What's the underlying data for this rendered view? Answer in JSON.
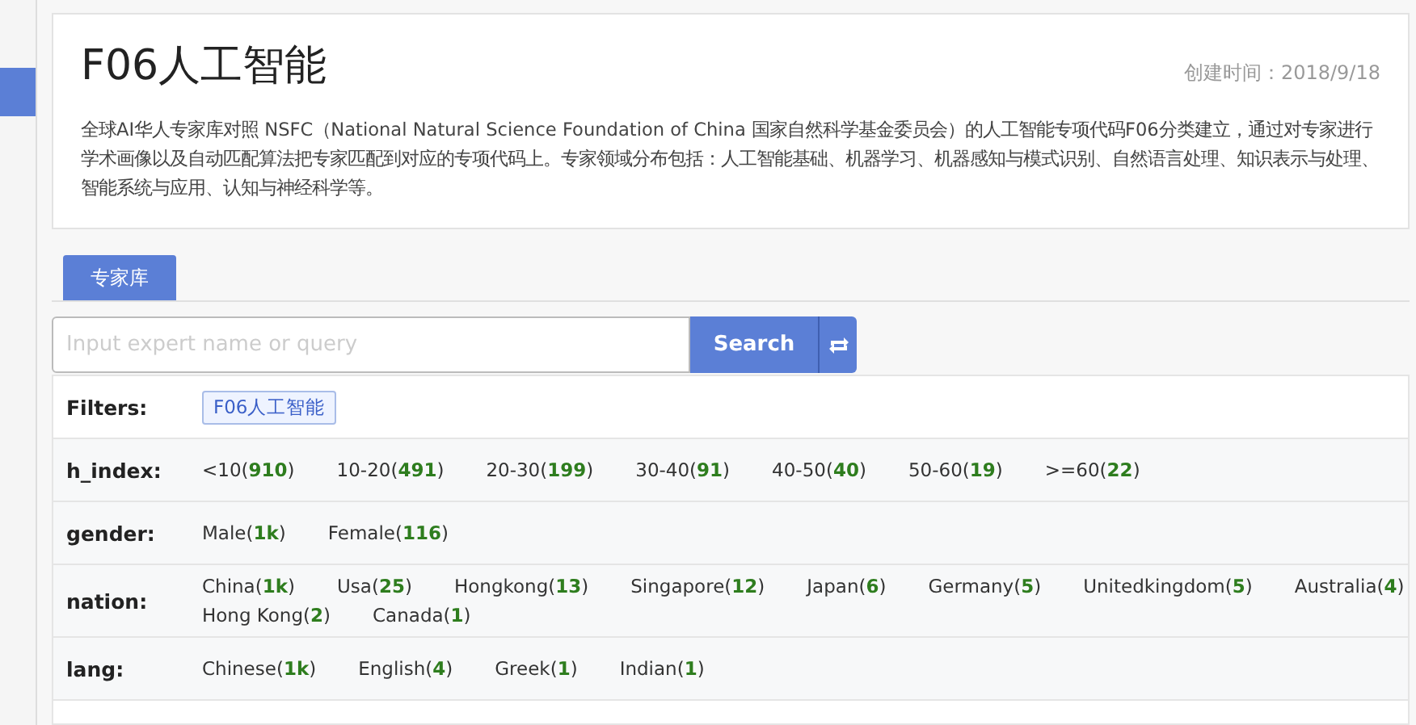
{
  "header": {
    "title": "F06人工智能",
    "created": "创建时间：2018/9/18",
    "description": "全球AI华人专家库对照 NSFC（National Natural Science Foundation of China 国家自然科学基金委员会）的人工智能专项代码F06分类建立，通过对专家进行学术画像以及自动匹配算法把专家匹配到对应的专项代码上。专家领域分布包括：人工智能基础、机器学习、机器感知与模式识别、自然语言处理、知识表示与处理、智能系统与应用、认知与神经科学等。"
  },
  "tabs": [
    {
      "label": "专家库",
      "selected": true
    }
  ],
  "search": {
    "placeholder": "Input expert name or query",
    "button": "Search"
  },
  "filters": {
    "label": "Filters:",
    "tags": [
      "F06人工智能"
    ]
  },
  "facets": [
    {
      "name": "h_index:",
      "items": [
        "<10(**910**)",
        "10-20(**491**)",
        "20-30(**199**)",
        "30-40(**91**)",
        "40-50(**40**)",
        "50-60(**19**)",
        ">=60(**22**)"
      ]
    },
    {
      "name": "gender:",
      "items": [
        "Male(**1k**)",
        "Female(**116**)"
      ]
    },
    {
      "name": "nation:",
      "items": [
        "China(**1k**)",
        "Usa(**25**)",
        "Hongkong(**13**)",
        "Singapore(**12**)",
        "Japan(**6**)",
        "Germany(**5**)",
        "Unitedkingdom(**5**)",
        "Australia(**4**)",
        "Hong Kong(**2**)",
        "Canada(**1**)"
      ]
    },
    {
      "name": "lang:",
      "items": [
        "Chinese(**1k**)",
        "English(**4**)",
        "Greek(**1**)",
        "Indian(**1**)"
      ]
    }
  ]
}
